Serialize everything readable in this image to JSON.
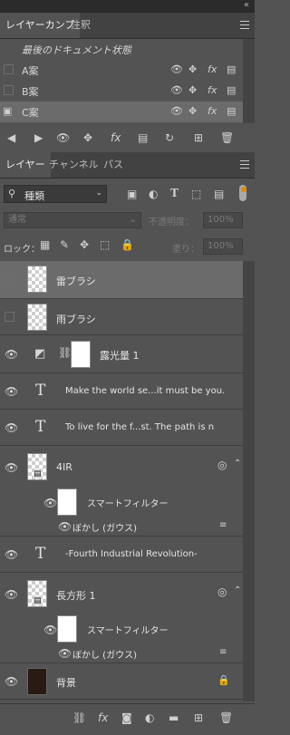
{
  "panels": {
    "comps": {
      "tabs": [
        "レイヤーカンプ",
        "注釈"
      ],
      "last_state": "最後のドキュメント状態",
      "comps": [
        "A案",
        "B案",
        "C案"
      ]
    },
    "layers": {
      "tabs": [
        "レイヤー",
        "チャンネル",
        "パス"
      ],
      "filter_kind": "種類",
      "blend_mode": "通常",
      "opacity_label": "不透明度：",
      "opacity_value": "100%",
      "lock_label": "ロック：",
      "fill_label": "塗り：",
      "fill_value": "100%",
      "items": [
        {
          "name": "雷ブラシ"
        },
        {
          "name": "雨ブラシ"
        },
        {
          "name": "露光量 1"
        },
        {
          "name": "Make the world se...it must be you."
        },
        {
          "name": "To live for  the f...st. The path is n"
        },
        {
          "name": "4IR",
          "smart_filter": "スマートフィルター",
          "filter_name": "ぼかし (ガウス)"
        },
        {
          "name": "-Fourth Industrial Revolution-"
        },
        {
          "name": "長方形 1",
          "smart_filter": "スマートフィルター",
          "filter_name": "ぼかし (ガウス)"
        },
        {
          "name": "背景"
        }
      ]
    }
  },
  "icons": {
    "collapse": "double-chevron-left-icon",
    "visibility": "eye-icon",
    "position": "move-icon",
    "fx": "fx-icon",
    "appearance": "document-icon"
  },
  "colors": {
    "panel": "#535353",
    "header": "#424242",
    "selected": "#6b6b6b",
    "dark": "#2b2b2b"
  }
}
